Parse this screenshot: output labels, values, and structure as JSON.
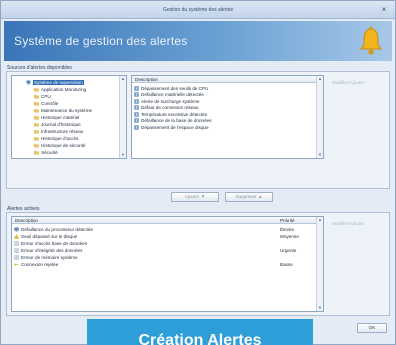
{
  "window": {
    "title": "Gestion du système des alertes",
    "close_glyph": "×"
  },
  "banner": {
    "heading": "Système de gestion des alertes",
    "icon": "bell-icon",
    "accent": "#f2b51e"
  },
  "top_panel": {
    "label": "Sources d'alertes disponibles",
    "side_link": "Modifier/Ajouter",
    "tree": [
      {
        "label": "Système de supervision",
        "icon": "computer-icon",
        "selected": true
      },
      {
        "label": "Application Monitoring",
        "icon": "folder-icon"
      },
      {
        "label": "CPU",
        "icon": "folder-icon"
      },
      {
        "label": "Contrôle",
        "icon": "folder-icon"
      },
      {
        "label": "Maintenance du système",
        "icon": "folder-icon"
      },
      {
        "label": "Historique matériel",
        "icon": "folder-icon"
      },
      {
        "label": "Journal d'historique",
        "icon": "folder-icon"
      },
      {
        "label": "Infrastructure réseau",
        "icon": "folder-icon"
      },
      {
        "label": "Historique d'accès",
        "icon": "folder-icon"
      },
      {
        "label": "Historique de sécurité",
        "icon": "folder-icon"
      },
      {
        "label": "Sécurité",
        "icon": "folder-icon"
      }
    ],
    "list_header": {
      "description": "Description"
    },
    "list": [
      "Dépassement des seuils de CPU",
      "Défaillance matérielle détectée",
      "Alerte de surcharge système",
      "Défaut de connexion réseau",
      "Température excessive détectée",
      "Défaillance de la base de données",
      "Dépassement de l'espace disque"
    ],
    "buttons": {
      "add": "Ajouter ▼",
      "remove": "Supprimer ▲"
    }
  },
  "bottom_panel": {
    "label": "Alertes actives",
    "side_link": "Modifier/Ajouter",
    "columns": {
      "description": "Description",
      "priority": "Priorité"
    },
    "rows": [
      {
        "text": "Défaillance du processeur détectée",
        "priority": "Élevée",
        "icon": "monitor-icon"
      },
      {
        "text": "Seuil dépassé sur le disque",
        "priority": "Moyenne",
        "icon": "warning-icon"
      },
      {
        "text": "Erreur d'accès base de données",
        "priority": "",
        "icon": "list-icon"
      },
      {
        "text": "Erreur d'intégrité des données",
        "priority": "Urgente",
        "icon": "list-icon"
      },
      {
        "text": "Erreur de mémoire système",
        "priority": "",
        "icon": "list-icon"
      },
      {
        "text": "Connexion rejetée",
        "priority": "Basse",
        "icon": "key-icon"
      }
    ]
  },
  "footer": {
    "ok_button": "OK",
    "overlay_caption": "Création Alertes"
  },
  "colors": {
    "banner_start": "#3a75b8",
    "overlay": "#2e9ed9",
    "selection": "#2f6cb5"
  }
}
